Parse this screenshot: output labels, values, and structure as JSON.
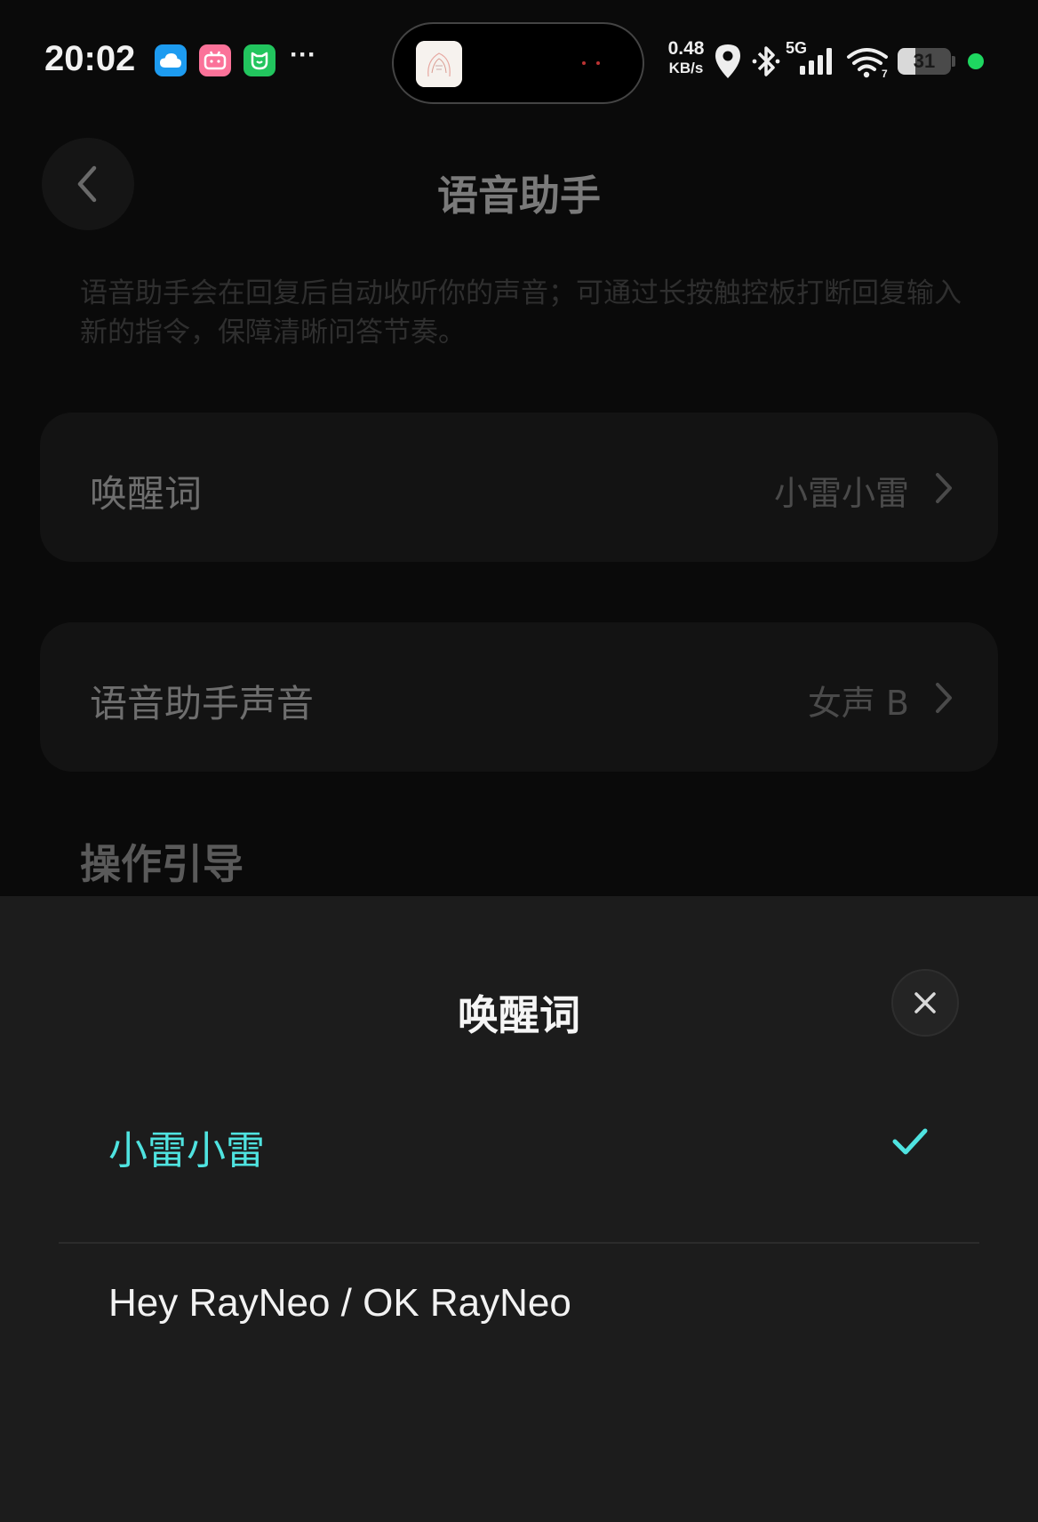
{
  "status_bar": {
    "time": "20:02",
    "net_speed_value": "0.48",
    "net_speed_unit": "KB/s",
    "network_label": "5G",
    "battery_level": "31",
    "app_icons": [
      "cloud-app-icon",
      "bilibili-icon",
      "mi-home-icon"
    ],
    "more_indicator": "···"
  },
  "header": {
    "title": "语音助手"
  },
  "description": "语音助手会在回复后自动收听你的声音；可通过长按触控板打断回复输入新的指令，保障清晰问答节奏。",
  "settings": [
    {
      "label": "唤醒词",
      "value": "小雷小雷"
    },
    {
      "label": "语音助手声音",
      "value": "女声 B"
    }
  ],
  "section_title": "操作引导",
  "sheet": {
    "title": "唤醒词",
    "options": [
      {
        "label": "小雷小雷",
        "selected": true
      },
      {
        "label": "Hey RayNeo / OK RayNeo",
        "selected": false
      }
    ]
  },
  "colors": {
    "accent": "#4fe3e0",
    "sheet_bg": "#1c1c1c",
    "page_bg": "#0a0a0a",
    "status_dot": "#1ed760"
  }
}
